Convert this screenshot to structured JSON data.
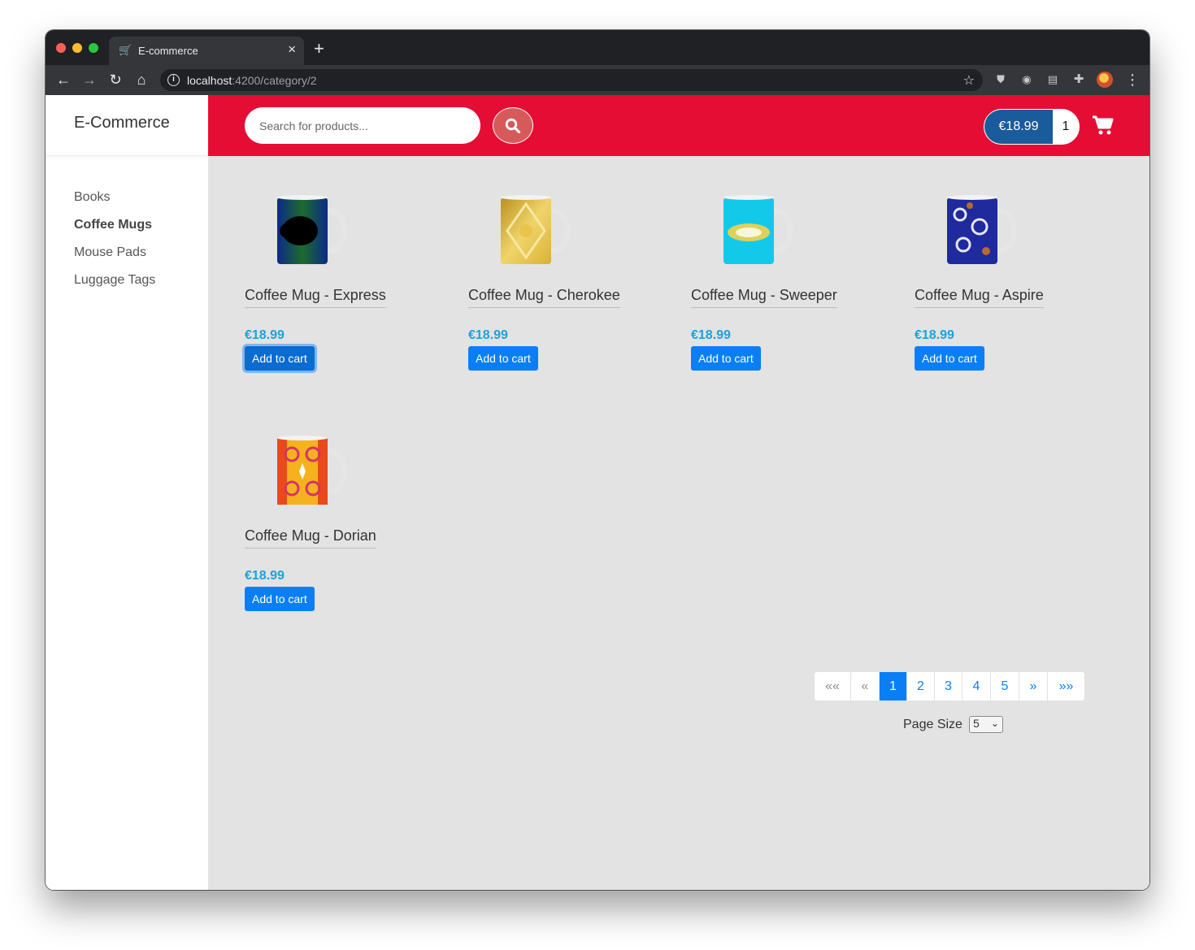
{
  "browser": {
    "tab_title": "E-commerce",
    "url_host": "localhost",
    "url_path": ":4200/category/2"
  },
  "sidebar": {
    "brand": "E-Commerce",
    "items": [
      {
        "label": "Books",
        "active": false
      },
      {
        "label": "Coffee Mugs",
        "active": true
      },
      {
        "label": "Mouse Pads",
        "active": false
      },
      {
        "label": "Luggage Tags",
        "active": false
      }
    ]
  },
  "header": {
    "search_placeholder": "Search for products...",
    "cart_total": "€18.99",
    "cart_count": "1"
  },
  "products": [
    {
      "name": "Coffee Mug - Express",
      "price": "€18.99",
      "button": "Add to cart",
      "mug_colors": [
        "#0b2a8a",
        "#1d6b2b",
        "#000000"
      ]
    },
    {
      "name": "Coffee Mug - Cherokee",
      "price": "€18.99",
      "button": "Add to cart",
      "mug_colors": [
        "#d9b234",
        "#f0d46a",
        "#b8911e"
      ]
    },
    {
      "name": "Coffee Mug - Sweeper",
      "price": "€18.99",
      "button": "Add to cart",
      "mug_colors": [
        "#13c9ea",
        "#f5d24a",
        "#2ab0e0"
      ]
    },
    {
      "name": "Coffee Mug - Aspire",
      "price": "€18.99",
      "button": "Add to cart",
      "mug_colors": [
        "#1f2a9e",
        "#e6e6f5",
        "#b86a2e"
      ]
    },
    {
      "name": "Coffee Mug - Dorian",
      "price": "€18.99",
      "button": "Add to cart",
      "mug_colors": [
        "#e84a1c",
        "#f5b21e",
        "#d6326a"
      ]
    }
  ],
  "pagination": {
    "first": "««",
    "prev": "«",
    "pages": [
      "1",
      "2",
      "3",
      "4",
      "5"
    ],
    "current": "1",
    "next": "»",
    "last": "»»"
  },
  "page_size": {
    "label": "Page Size",
    "value": "5"
  },
  "colors": {
    "header_red": "#e60d35",
    "primary_blue": "#0a7ff5",
    "price_blue": "#1aa3dd",
    "cart_total_bg": "#1a5b9c"
  }
}
